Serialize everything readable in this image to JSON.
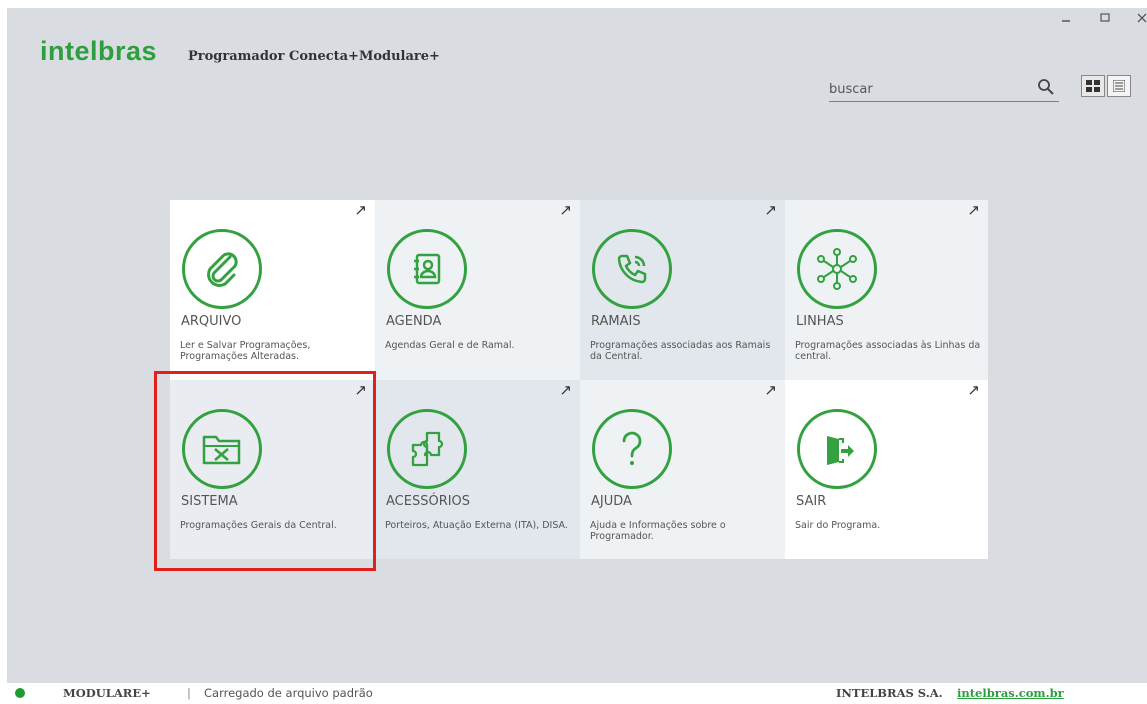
{
  "app": {
    "logo": "intelbras",
    "title": "Programador Conecta+Modulare+",
    "window_controls": [
      "minimize-icon",
      "maximize-icon",
      "close-icon"
    ]
  },
  "search": {
    "placeholder": "buscar",
    "value": ""
  },
  "view_toggle": {
    "options": [
      "grid-view-icon",
      "list-view-icon"
    ],
    "selected": "grid-view-icon"
  },
  "tiles": [
    {
      "title": "ARQUIVO",
      "desc": "Ler e Salvar Programações, Programações Alteradas.",
      "icon": "paperclip-icon",
      "bg": "#ffffff"
    },
    {
      "title": "AGENDA",
      "desc": "Agendas Geral e de Ramal.",
      "icon": "contact-book-icon",
      "bg": "#eef2f5"
    },
    {
      "title": "RAMAIS",
      "desc": "Programações associadas aos Ramais da Central.",
      "icon": "phone-ringing-icon",
      "bg": "#e2e7ed"
    },
    {
      "title": "LINHAS",
      "desc": "Programações associadas às Linhas da central.",
      "icon": "network-hub-icon",
      "bg": "#eef2f5"
    },
    {
      "title": "SISTEMA",
      "desc": "Programações Gerais da Central.",
      "icon": "folder-tools-icon",
      "bg": "#e9edf1"
    },
    {
      "title": "ACESSÓRIOS",
      "desc": "Porteiros, Atuação Externa (ITA), DISA.",
      "icon": "puzzle-icon",
      "bg": "#e2e7ed"
    },
    {
      "title": "AJUDA",
      "desc": "Ajuda e Informações sobre o Programador.",
      "icon": "question-mark-icon",
      "bg": "#eef2f5"
    },
    {
      "title": "SAIR",
      "desc": "Sair do Programa.",
      "icon": "exit-door-icon",
      "bg": "#ffffff"
    }
  ],
  "tile_arrow": "↗",
  "status": {
    "model": "MODULARE+",
    "separator": "|",
    "message": "Carregado de arquivo padrão",
    "company": "INTELBRAS S.A.",
    "link": "intelbras.com.br"
  },
  "colors": {
    "accent": "#33a13f",
    "highlight": "#e1201e",
    "background": "#d9dde2"
  }
}
